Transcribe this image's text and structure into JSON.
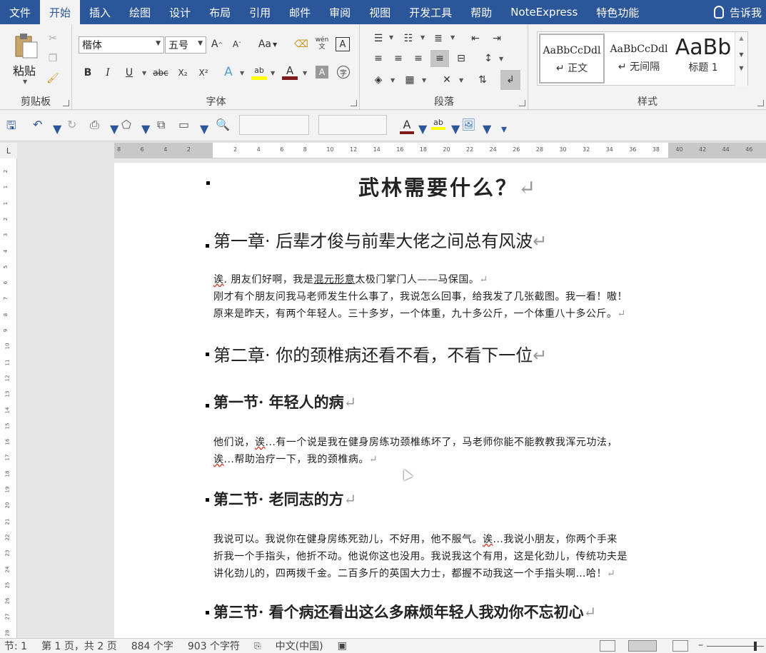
{
  "tabs": [
    {
      "label": "文件",
      "active": false
    },
    {
      "label": "开始",
      "active": true
    },
    {
      "label": "插入",
      "active": false
    },
    {
      "label": "绘图",
      "active": false
    },
    {
      "label": "设计",
      "active": false
    },
    {
      "label": "布局",
      "active": false
    },
    {
      "label": "引用",
      "active": false
    },
    {
      "label": "邮件",
      "active": false
    },
    {
      "label": "审阅",
      "active": false
    },
    {
      "label": "视图",
      "active": false
    },
    {
      "label": "开发工具",
      "active": false
    },
    {
      "label": "帮助",
      "active": false
    },
    {
      "label": "NoteExpress",
      "active": false
    },
    {
      "label": "特色功能",
      "active": false
    }
  ],
  "tell_me": "告诉我",
  "ribbon": {
    "clipboard": {
      "label": "剪贴板",
      "paste_label": "粘贴"
    },
    "font": {
      "label": "字体",
      "font_name": "楷体",
      "font_size": "五号",
      "change_case": "Aa",
      "phonetic": "wén\n文",
      "bold": "B",
      "italic": "I",
      "underline": "U",
      "strike": "abc",
      "subscript": "X₂",
      "superscript": "X²",
      "color_a": "A"
    },
    "paragraph": {
      "label": "段落"
    },
    "styles": {
      "label": "样式",
      "items": [
        {
          "sample": "AaBbCcDdl",
          "name": "↵ 正文"
        },
        {
          "sample": "AaBbCcDdl",
          "name": "↵ 无间隔"
        },
        {
          "sample": "AaBb",
          "name": "标题 1"
        }
      ]
    }
  },
  "document": {
    "title": "武林需要什么？",
    "paragraph_mark": "↵",
    "ch1_heading": "第一章· 后辈才俊与前辈大佬之间总有风波",
    "ch1_p1_a": "诶",
    "ch1_p1_b": ". 朋友们好啊，我是",
    "ch1_p1_c": "混元形意",
    "ch1_p1_d": "太极门掌门人——马保国。",
    "ch1_p2": "刚才有个朋友问我马老师发生什么事了，我说怎么回事，给我发了几张截图。我一看！嗷！",
    "ch1_p3": "原来是昨天，有两个年轻人。三十多岁，一个体重，九十多公斤，一个体重八十多公斤。",
    "ch2_heading": "第二章· 你的颈椎病还看不看，不看下一位",
    "s1_heading": "第一节· 年轻人的病",
    "s1_p1_a": "他们说，",
    "s1_p1_b": "诶",
    "s1_p1_c": "...有一个说是我在健身房练功颈椎练坏了，马老师你能不能教教我浑元功法，",
    "s1_p2_a": "诶",
    "s1_p2_b": "...帮助治疗一下，我的颈椎病。",
    "s2_heading": "第二节· 老同志的方",
    "s2_p1_a": "我说可以。我说你在健身房练死劲儿，不好用，他不服气。",
    "s2_p1_b": "诶",
    "s2_p1_c": "...我说小朋友，你两个手来",
    "s2_p2": "折我一个手指头，他折不动。他说你这也没用。我说我这个有用，这是化劲儿，传统功夫是",
    "s2_p3": "讲化劲儿的，四两拨千金。二百多斤的英国大力士，都握不动我这一个手指头啊…哈！",
    "s3_heading": "第三节· 看个病还看出这么多麻烦年轻人我劝你不忘初心"
  },
  "status": {
    "section": "节: 1",
    "page": "第 1 页，共 2 页",
    "words": "884 个字",
    "chars": "903 个字符",
    "language": "中文(中国)"
  },
  "ruler": {
    "h_ticks": [
      "8",
      "6",
      "4",
      "2",
      "",
      "2",
      "4",
      "6",
      "8",
      "10",
      "12",
      "14",
      "16",
      "18",
      "20",
      "22",
      "24",
      "26",
      "28",
      "30",
      "32",
      "34",
      "36",
      "38",
      "40",
      "42",
      "44",
      "46"
    ],
    "v_ticks": [
      "2",
      "1",
      "1",
      "2",
      "3",
      "4",
      "5",
      "6",
      "7",
      "8",
      "9",
      "10",
      "11",
      "12",
      "13",
      "14",
      "15",
      "16",
      "17",
      "18",
      "19",
      "20",
      "21",
      "22",
      "23",
      "24",
      "25",
      "26",
      "27",
      "28"
    ]
  },
  "colors": {
    "accent": "#2b579a",
    "font_color": "#7f1d1d",
    "highlight": "#ffff00"
  }
}
